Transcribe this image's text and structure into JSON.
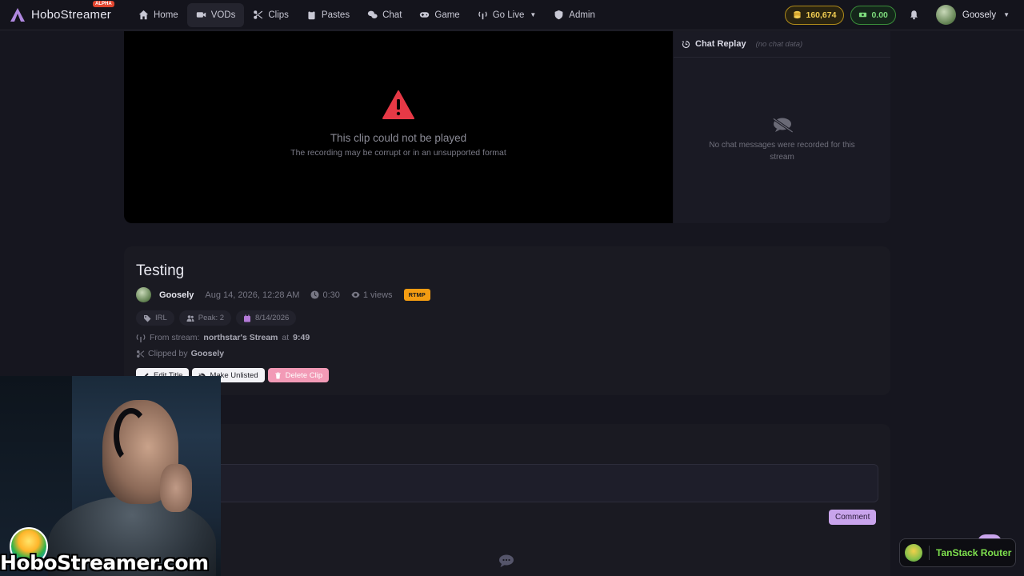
{
  "nav": {
    "brand": "HoboStreamer",
    "badge": "ALPHA",
    "items": [
      {
        "label": "Home",
        "icon": "home-icon"
      },
      {
        "label": "VODs",
        "icon": "video-icon"
      },
      {
        "label": "Clips",
        "icon": "scissors-icon"
      },
      {
        "label": "Pastes",
        "icon": "paste-icon"
      },
      {
        "label": "Chat",
        "icon": "chat-icon"
      },
      {
        "label": "Game",
        "icon": "gamepad-icon"
      },
      {
        "label": "Go Live",
        "icon": "broadcast-icon"
      },
      {
        "label": "Admin",
        "icon": "shield-icon"
      }
    ],
    "coins": "160,674",
    "balance": "0.00",
    "username": "Goosely"
  },
  "player": {
    "error_title": "This clip could not be played",
    "error_sub": "The recording may be corrupt or in an unsupported format"
  },
  "chat_replay": {
    "title": "Chat Replay",
    "note": "(no chat data)",
    "empty": "No chat messages were recorded for this stream"
  },
  "clip": {
    "title": "Testing",
    "author": "Goosely",
    "date": "Aug 14, 2026, 12:28 AM",
    "duration": "0:30",
    "views": "1 views",
    "protocol": "RTMP",
    "tags": {
      "category": "IRL",
      "peak": "Peak: 2",
      "date": "8/14/2026"
    },
    "from_prefix": "From stream:",
    "from_stream": "northstar's Stream",
    "from_at": "at",
    "from_time": "9:49",
    "clipped_prefix": "Clipped by",
    "clipped_by": "Goosely",
    "actions": {
      "edit": "Edit Title",
      "unlist": "Make Unlisted",
      "delete": "Delete Clip"
    }
  },
  "comments": {
    "button": "Comment"
  },
  "overlay": {
    "brand": "HoboStreamer.com"
  },
  "devtools": {
    "label": "TanStack Router"
  },
  "colors": {
    "accent": "#c9a4ec",
    "rtmp": "#f39c12",
    "danger": "#f29ab6",
    "coins": "#f0cc52",
    "money": "#7ddc7d"
  }
}
